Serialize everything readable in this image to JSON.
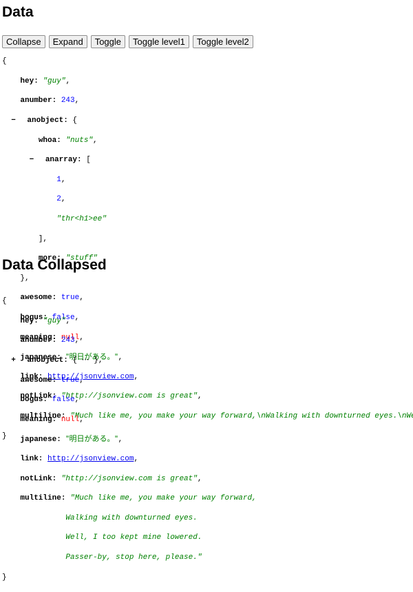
{
  "sections": {
    "data_title": "Data",
    "collapsed_title": "Data Collapsed"
  },
  "toolbar": {
    "collapse": "Collapse",
    "expand": "Expand",
    "toggle": "Toggle",
    "toggle_level1": "Toggle level1",
    "toggle_level2": "Toggle level2"
  },
  "json": {
    "hey": "\"guy\"",
    "anumber": "243",
    "whoa": "\"nuts\"",
    "anarray": [
      "1",
      "2",
      "\"thr<h1>ee\""
    ],
    "more": "\"stuff\"",
    "awesome": "true",
    "bogus": "false",
    "meaning": "null",
    "japanese": "\"明日がある。\"",
    "link": "http://jsonview.com",
    "notLink": "\"http://jsonview.com is great\"",
    "multiline_escaped": "\"Much like me, you make your way forward,\\nWalking with downturned eyes.\\nWell,",
    "multiline_lines": [
      "\"Much like me, you make your way forward,",
      "Walking with downturned eyes.",
      "Well, I too kept mine lowered.",
      "Passer-by, stop here, please.\""
    ],
    "collapsed_placeholder": "⋯"
  }
}
